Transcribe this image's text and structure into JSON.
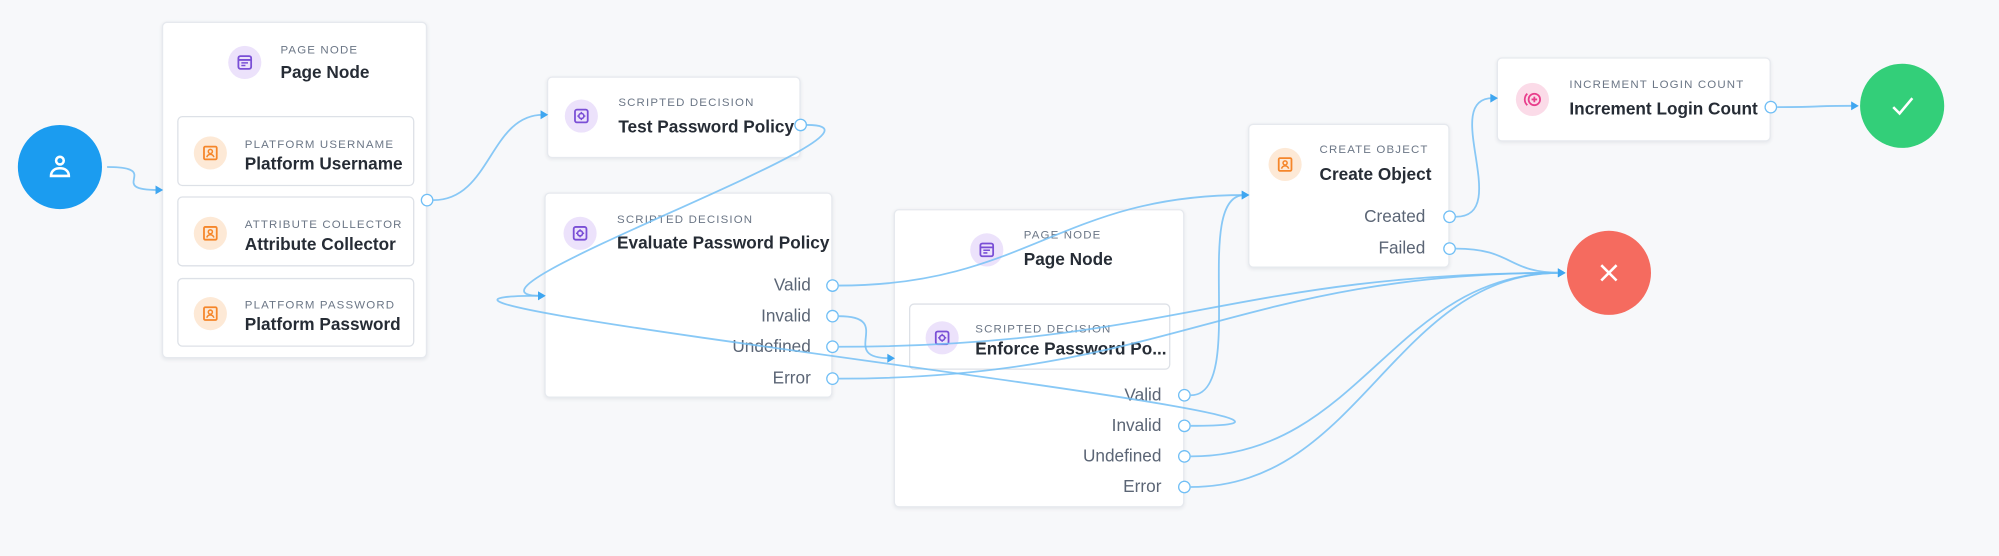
{
  "colors": {
    "start": "#1b9cf0",
    "success": "#33cf79",
    "failure": "#f56b5f",
    "edge": "#74bff4",
    "purple_icon": "#7a4fd6",
    "orange_icon": "#f5862a",
    "pink_icon": "#e83e8c"
  },
  "start": {
    "icon": "user-icon"
  },
  "success": {
    "icon": "check-icon"
  },
  "failure": {
    "icon": "x-icon"
  },
  "nodes": [
    {
      "id": "page1",
      "kind": "Page Node",
      "title": "Page Node",
      "icon": "page-icon",
      "children": [
        {
          "kind": "Platform Username",
          "title": "Platform Username",
          "icon": "user-card-icon"
        },
        {
          "kind": "Attribute Collector",
          "title": "Attribute Collector",
          "icon": "user-card-icon"
        },
        {
          "kind": "Platform Password",
          "title": "Platform Password",
          "icon": "user-card-icon"
        }
      ],
      "outputs": []
    },
    {
      "id": "test",
      "kind": "Scripted Decision",
      "title": "Test Password Policy",
      "icon": "script-icon",
      "children": [],
      "outputs": []
    },
    {
      "id": "eval",
      "kind": "Scripted Decision",
      "title": "Evaluate Password Policy",
      "icon": "script-icon",
      "children": [],
      "outputs": [
        "Valid",
        "Invalid",
        "Undefined",
        "Error"
      ]
    },
    {
      "id": "page2",
      "kind": "Page Node",
      "title": "Page Node",
      "icon": "page-icon",
      "children": [
        {
          "kind": "Scripted Decision",
          "title": "Enforce Password Po...",
          "icon": "script-icon"
        }
      ],
      "outputs": [
        "Valid",
        "Invalid",
        "Undefined",
        "Error"
      ]
    },
    {
      "id": "create",
      "kind": "Create Object",
      "title": "Create Object",
      "icon": "user-card-icon",
      "children": [],
      "outputs": [
        "Created",
        "Failed"
      ]
    },
    {
      "id": "incr",
      "kind": "Increment Login Count",
      "title": "Increment Login Count",
      "icon": "increment-icon",
      "children": [],
      "outputs": []
    }
  ],
  "edges": [
    [
      "start",
      "page1"
    ],
    [
      "page1",
      "test"
    ],
    [
      "test",
      "eval"
    ],
    [
      "eval.Valid",
      "create"
    ],
    [
      "eval.Invalid",
      "page2"
    ],
    [
      "eval.Undefined",
      "failure"
    ],
    [
      "eval.Error",
      "failure"
    ],
    [
      "page2.Valid",
      "create"
    ],
    [
      "page2.Invalid",
      "eval"
    ],
    [
      "page2.Undefined",
      "failure"
    ],
    [
      "page2.Error",
      "failure"
    ],
    [
      "create.Created",
      "incr"
    ],
    [
      "create.Failed",
      "failure"
    ],
    [
      "incr",
      "success"
    ]
  ]
}
